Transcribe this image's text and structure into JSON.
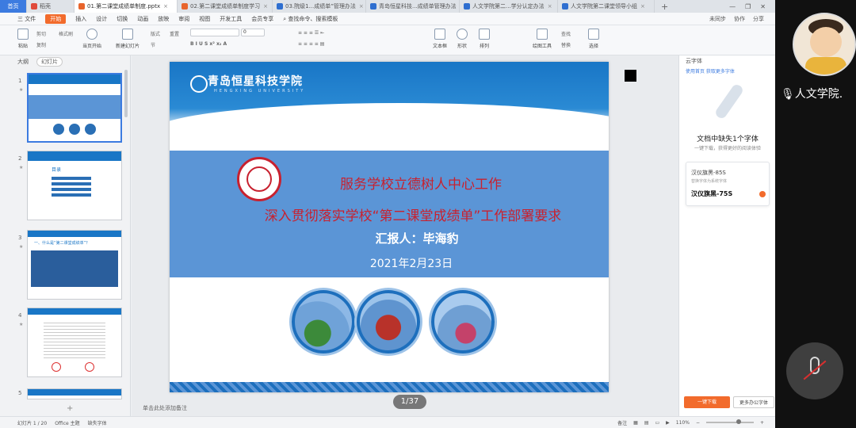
{
  "tabs": [
    {
      "label": "首页",
      "kind": "home"
    },
    {
      "label": "稻壳",
      "kind": "docer"
    },
    {
      "label": "01.第二课堂成绩单制度.pptx",
      "kind": "ppt",
      "active": true
    },
    {
      "label": "02.第二课堂成绩单制度学习",
      "kind": "ppt"
    },
    {
      "label": "03.院级1...成绩单”管理办法",
      "kind": "doc"
    },
    {
      "label": "青岛恒星科技...成绩单管理办法",
      "kind": "doc"
    },
    {
      "label": "人文学院第二...学分认定办法",
      "kind": "doc"
    },
    {
      "label": "人文学院第二课堂领导小组",
      "kind": "doc"
    }
  ],
  "tab_plus": "+",
  "menu": {
    "file": "三 文件",
    "start": "开始",
    "items": [
      "插入",
      "设计",
      "切换",
      "动画",
      "放映",
      "审阅",
      "视图",
      "开发工具",
      "会员专享"
    ],
    "search": "查找命令、搜索模板",
    "right": [
      "未同步",
      "协作",
      "分享"
    ]
  },
  "ribbon": {
    "labels": [
      "粘贴",
      "剪切",
      "复制",
      "格式刷",
      "当页开始",
      "新建幻灯片",
      "版式",
      "节",
      "重置",
      "文本框",
      "形状",
      "排列",
      "绘图工具",
      "查找",
      "替换",
      "选择"
    ],
    "font_value": "",
    "size_value": "0"
  },
  "side": {
    "tab_outline": "大纲",
    "tab_slides": "幻灯片",
    "thumb_numbers": [
      "1",
      "2",
      "3",
      "4",
      "5"
    ],
    "thumb2_title": "目录",
    "thumb3_title": "一、什么是“第二课堂成绩单”？"
  },
  "slide": {
    "school_cn": "青岛恒星科技学院",
    "school_en": "HENGXING UNIVERSITY",
    "line1": "服务学校立德树人中心工作",
    "line2": "深入贯彻落实学校“第二课堂成绩单”工作部署要求",
    "line3": "汇报人：毕海豹",
    "line4": "2021年2月23日"
  },
  "page_indicator": "1/37",
  "notes_hint": "单击此处添加备注",
  "right_pane": {
    "header": "云字体",
    "link": "使用首页 获取更多字体",
    "missing_title": "文档中缺失1个字体",
    "missing_sub": "一键下载，获得更好的阅读体验",
    "font1": "汉仪旗黑-85S",
    "font1_sub": "替换字体为系统字体",
    "font2": "汉仪旗黑-75S",
    "btn_download": "一键下载",
    "btn_more": "更多办公字体"
  },
  "status": {
    "slide_count": "幻灯片 1 / 20",
    "theme": "Office 主题",
    "missing_font": "缺失字体",
    "notes": "备注",
    "zoom": "110%"
  },
  "camera_label": "人文学院.",
  "colors": {
    "accent": "#f26b2c",
    "wps_blue": "#3c7be0",
    "slide_blue": "#5b95d6",
    "title_red": "#c8212f"
  }
}
